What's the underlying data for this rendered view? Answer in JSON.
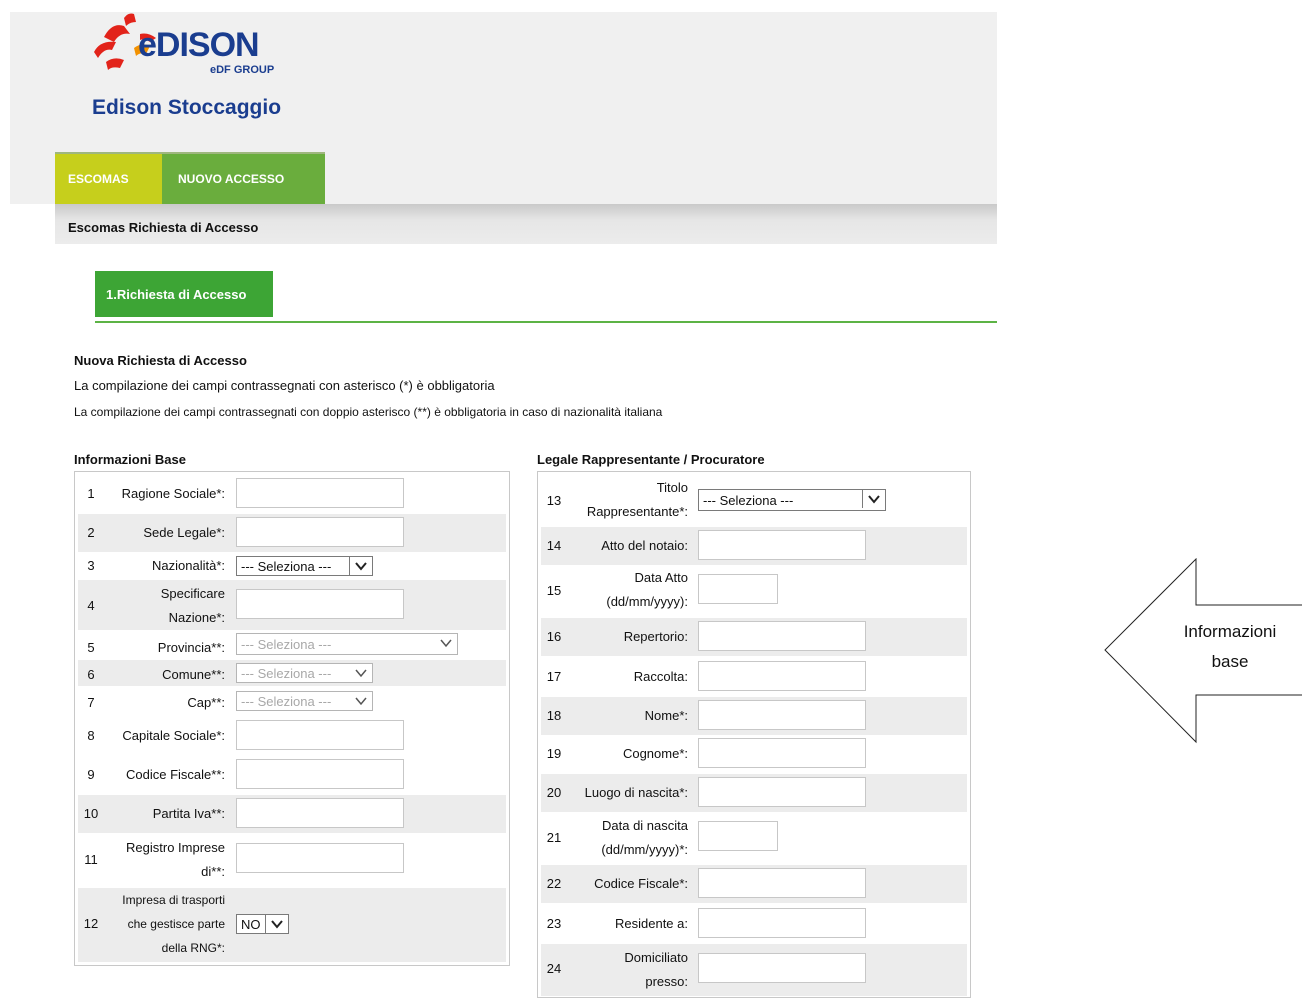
{
  "brand": {
    "name": "eDISON",
    "group": "eDF GROUP",
    "subtitle": "Edison Stoccaggio"
  },
  "nav": {
    "tab1": "ESCOMAS",
    "tab2": "NUOVO ACCESSO"
  },
  "subbar": {
    "title": "Escomas Richiesta di Accesso"
  },
  "step": {
    "label": "1.Richiesta di Accesso"
  },
  "intro": {
    "title": "Nuova Richiesta di Accesso",
    "line1": "La compilazione dei campi contrassegnati con asterisco (*) è obbligatoria",
    "line2": "La compilazione dei campi contrassegnati con doppio asterisco (**) è obbligatoria in caso di nazionalità italiana"
  },
  "left_section": {
    "title": "Informazioni Base",
    "rows": [
      {
        "n": "1",
        "label": "Ragione Sociale*:"
      },
      {
        "n": "2",
        "label": "Sede Legale*:"
      },
      {
        "n": "3",
        "label": "Nazionalità*:",
        "select": "--- Seleziona ---"
      },
      {
        "n": "4",
        "label1": "Specificare",
        "label2": "Nazione*:"
      },
      {
        "n": "5",
        "label": "Provincia**:",
        "select": "--- Seleziona ---"
      },
      {
        "n": "6",
        "label": "Comune**:",
        "select": "--- Seleziona ---"
      },
      {
        "n": "7",
        "label": "Cap**:",
        "select": "--- Seleziona ---"
      },
      {
        "n": "8",
        "label": "Capitale Sociale*:"
      },
      {
        "n": "9",
        "label": "Codice Fiscale**:"
      },
      {
        "n": "10",
        "label": "Partita Iva**:"
      },
      {
        "n": "11",
        "label1": "Registro Imprese",
        "label2": "di**:"
      },
      {
        "n": "12",
        "label1": "Impresa di trasporti",
        "label2": "che gestisce parte",
        "label3": "della RNG*:",
        "select": "NO"
      }
    ]
  },
  "right_section": {
    "title": "Legale Rappresentante / Procuratore",
    "rows": [
      {
        "n": "13",
        "label1": "Titolo",
        "label2": "Rappresentante*:",
        "select": "--- Seleziona ---"
      },
      {
        "n": "14",
        "label": "Atto del notaio:"
      },
      {
        "n": "15",
        "label1": "Data Atto",
        "label2": "(dd/mm/yyyy):"
      },
      {
        "n": "16",
        "label": "Repertorio:"
      },
      {
        "n": "17",
        "label": "Raccolta:"
      },
      {
        "n": "18",
        "label": "Nome*:"
      },
      {
        "n": "19",
        "label": "Cognome*:"
      },
      {
        "n": "20",
        "label": "Luogo di nascita*:"
      },
      {
        "n": "21",
        "label1": "Data di nascita",
        "label2": "(dd/mm/yyyy)*:"
      },
      {
        "n": "22",
        "label": "Codice Fiscale*:"
      },
      {
        "n": "23",
        "label": "Residente a:"
      },
      {
        "n": "24",
        "label1": "Domiciliato",
        "label2": "presso:"
      }
    ]
  },
  "callout": {
    "line1": "Informazioni",
    "line2": "base"
  },
  "colors": {
    "brand_blue": "#1a3d8f",
    "escomas_tab": "#c6cf1c",
    "nuovo_tab": "#6aad3d",
    "step_green": "#3da535"
  }
}
